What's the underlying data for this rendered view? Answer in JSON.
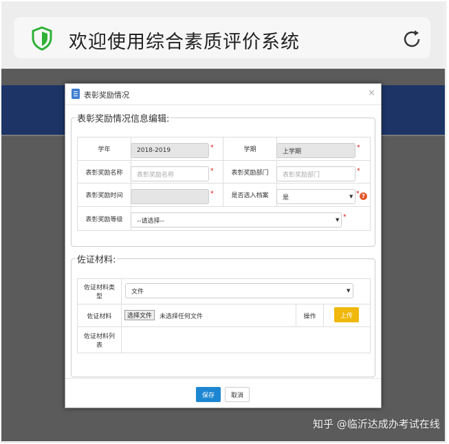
{
  "browser": {
    "title": "欢迎使用综合素质评价系统",
    "shield_color": "#2eb135"
  },
  "modal": {
    "title": "表彰奖励情况",
    "close": "×",
    "section1": {
      "legend": "表彰奖励情况信息编辑:",
      "school_year_label": "学年",
      "school_year_value": "2018-2019",
      "semester_label": "学期",
      "semester_value": "上学期",
      "award_name_label": "表彰奖励名称",
      "award_name_placeholder": "表彰奖励名称",
      "award_dept_label": "表彰奖励部门",
      "award_dept_placeholder": "表彰奖励部门",
      "award_time_label": "表彰奖励时间",
      "award_time_value": "",
      "archive_label": "是否选入档案",
      "archive_value": "是",
      "level_label": "表彰奖励等级",
      "level_value": "--请选择--"
    },
    "section2": {
      "legend": "佐证材料:",
      "type_label": "佐证材料类型",
      "type_value": "文件",
      "material_label": "佐证材料",
      "choose_file": "选择文件",
      "no_file": "未选择任何文件",
      "operation_label": "操作",
      "upload": "上传",
      "list_label": "佐证材料列表"
    },
    "save": "保存",
    "cancel": "取消"
  },
  "required_mark": "*",
  "help_mark": "?",
  "dropdown_arrow": "▼",
  "watermark": "知乎 @临沂达成办考试在线",
  "colors": {
    "save": "#1d86d2",
    "upload": "#f0b80c",
    "banner": "#1c3566",
    "required": "#dd0000"
  }
}
